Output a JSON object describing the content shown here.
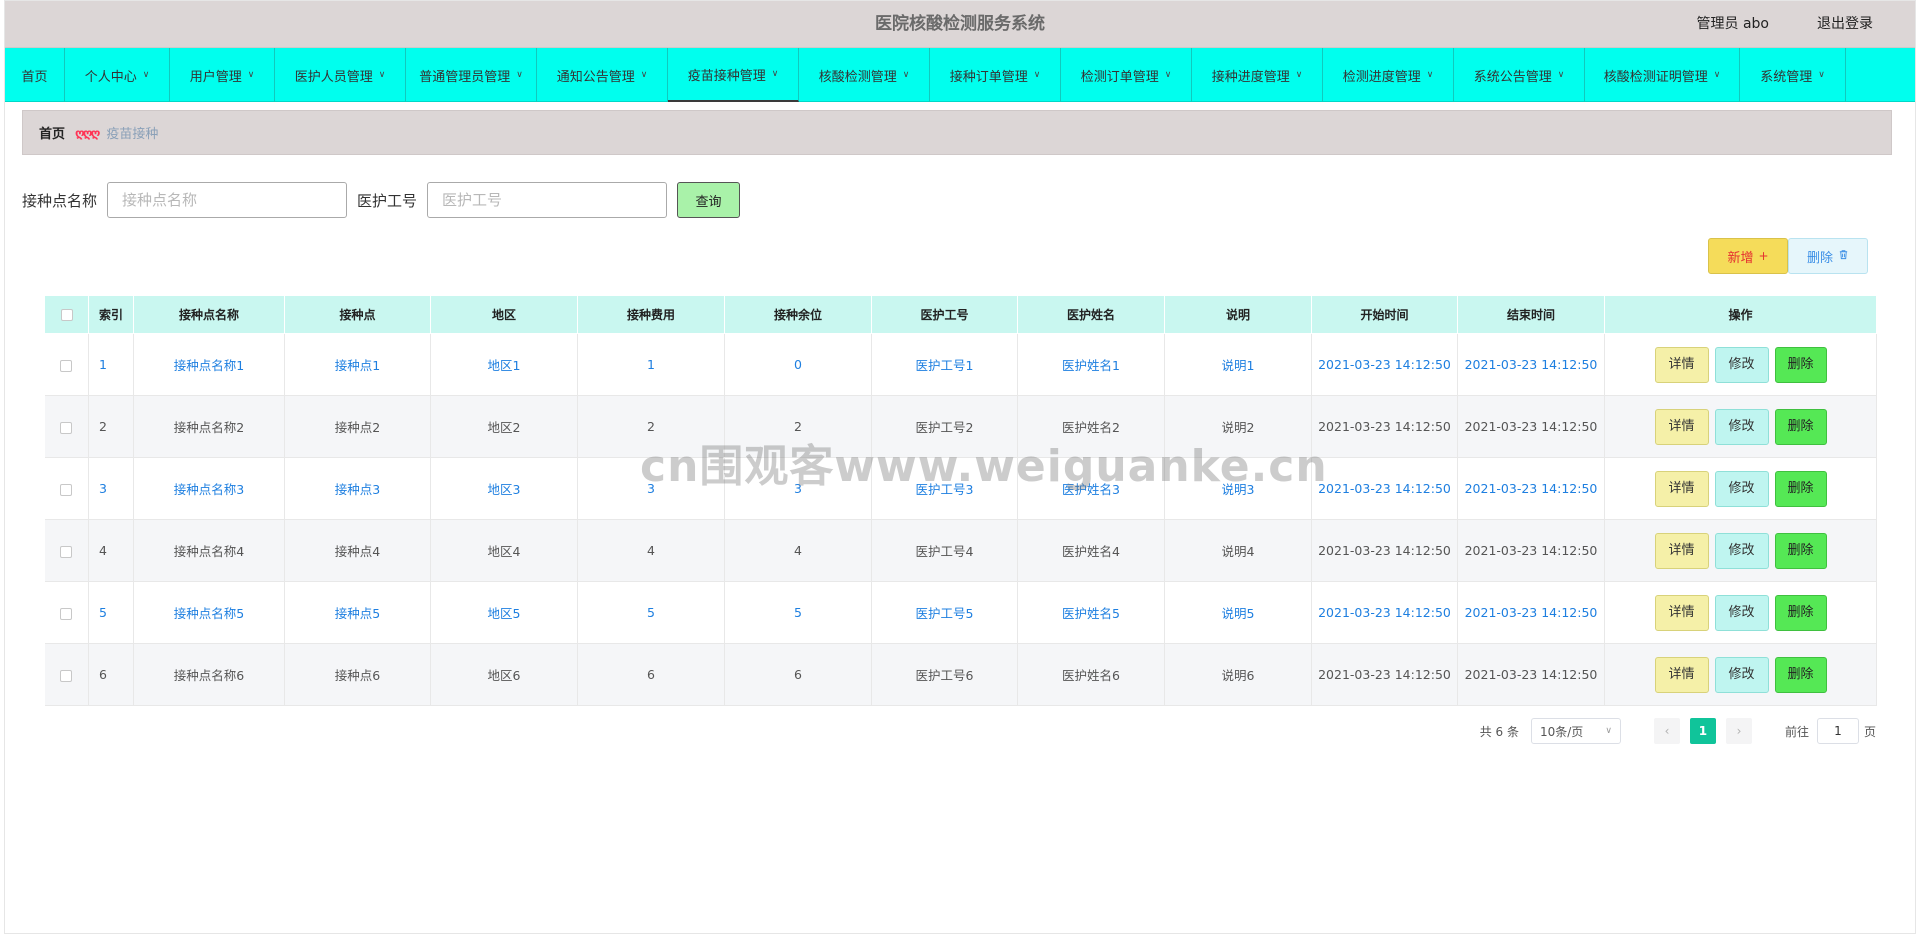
{
  "header": {
    "title": "医院核酸检测服务系统",
    "user": "管理员 abo",
    "logout": "退出登录"
  },
  "nav": [
    {
      "label": "首页",
      "caret": false,
      "active": false
    },
    {
      "label": "个人中心",
      "caret": true,
      "active": false
    },
    {
      "label": "用户管理",
      "caret": true,
      "active": false
    },
    {
      "label": "医护人员管理",
      "caret": true,
      "active": false
    },
    {
      "label": "普通管理员管理",
      "caret": true,
      "active": false
    },
    {
      "label": "通知公告管理",
      "caret": true,
      "active": false
    },
    {
      "label": "疫苗接种管理",
      "caret": true,
      "active": true
    },
    {
      "label": "核酸检测管理",
      "caret": true,
      "active": false
    },
    {
      "label": "接种订单管理",
      "caret": true,
      "active": false
    },
    {
      "label": "检测订单管理",
      "caret": true,
      "active": false
    },
    {
      "label": "接种进度管理",
      "caret": true,
      "active": false
    },
    {
      "label": "检测进度管理",
      "caret": true,
      "active": false
    },
    {
      "label": "系统公告管理",
      "caret": true,
      "active": false
    },
    {
      "label": "核酸检测证明管理",
      "caret": true,
      "active": false
    },
    {
      "label": "系统管理",
      "caret": true,
      "active": false
    }
  ],
  "breadcrumb": {
    "home": "首页",
    "separator": "ღღღ",
    "current": "疫苗接种"
  },
  "search": {
    "site_label": "接种点名称",
    "site_placeholder": "接种点名称",
    "staff_label": "医护工号",
    "staff_placeholder": "医护工号",
    "query_label": "查询"
  },
  "actions": {
    "add_label": "新增",
    "delete_label": "删除"
  },
  "table": {
    "headers": [
      "索引",
      "接种点名称",
      "接种点",
      "地区",
      "接种费用",
      "接种余位",
      "医护工号",
      "医护姓名",
      "说明",
      "开始时间",
      "结束时间",
      "操作"
    ],
    "rows": [
      {
        "index": "1",
        "site_name": "接种点名称1",
        "site": "接种点1",
        "region": "地区1",
        "fee": "1",
        "remaining": "0",
        "staff_no": "医护工号1",
        "staff_name": "医护姓名1",
        "note": "说明1",
        "start": "2021-03-23 14:12:50",
        "end": "2021-03-23 14:12:50"
      },
      {
        "index": "2",
        "site_name": "接种点名称2",
        "site": "接种点2",
        "region": "地区2",
        "fee": "2",
        "remaining": "2",
        "staff_no": "医护工号2",
        "staff_name": "医护姓名2",
        "note": "说明2",
        "start": "2021-03-23 14:12:50",
        "end": "2021-03-23 14:12:50"
      },
      {
        "index": "3",
        "site_name": "接种点名称3",
        "site": "接种点3",
        "region": "地区3",
        "fee": "3",
        "remaining": "3",
        "staff_no": "医护工号3",
        "staff_name": "医护姓名3",
        "note": "说明3",
        "start": "2021-03-23 14:12:50",
        "end": "2021-03-23 14:12:50"
      },
      {
        "index": "4",
        "site_name": "接种点名称4",
        "site": "接种点4",
        "region": "地区4",
        "fee": "4",
        "remaining": "4",
        "staff_no": "医护工号4",
        "staff_name": "医护姓名4",
        "note": "说明4",
        "start": "2021-03-23 14:12:50",
        "end": "2021-03-23 14:12:50"
      },
      {
        "index": "5",
        "site_name": "接种点名称5",
        "site": "接种点5",
        "region": "地区5",
        "fee": "5",
        "remaining": "5",
        "staff_no": "医护工号5",
        "staff_name": "医护姓名5",
        "note": "说明5",
        "start": "2021-03-23 14:12:50",
        "end": "2021-03-23 14:12:50"
      },
      {
        "index": "6",
        "site_name": "接种点名称6",
        "site": "接种点6",
        "region": "地区6",
        "fee": "6",
        "remaining": "6",
        "staff_no": "医护工号6",
        "staff_name": "医护姓名6",
        "note": "说明6",
        "start": "2021-03-23 14:12:50",
        "end": "2021-03-23 14:12:50"
      }
    ],
    "ops": {
      "detail": "详情",
      "edit": "修改",
      "remove": "删除"
    }
  },
  "pagination": {
    "total": "共 6 条",
    "page_size": "10条/页",
    "prev": "‹",
    "current_page": "1",
    "next": "›",
    "goto_label": "前往",
    "goto_value": "1",
    "page_suffix": "页"
  },
  "watermark": "cn围观客www.weiguanke.cn",
  "colors": {
    "nav_bg": "#00ffee",
    "header_bg": "#dcd6d6",
    "table_header_bg": "#c9f7f0",
    "link_blue": "#1e7fe0",
    "pager_active": "#10c49a"
  },
  "icons": {
    "nav_caret": "chevron-down-icon",
    "add": "plus-icon",
    "delete": "trash-icon",
    "size_select": "chevron-down-icon"
  }
}
